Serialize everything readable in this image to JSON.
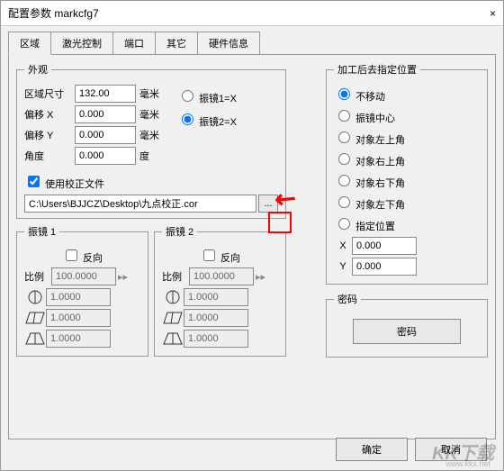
{
  "window": {
    "title": "配置参数 markcfg7"
  },
  "tabs": [
    "区域",
    "激光控制",
    "端口",
    "其它",
    "硬件信息"
  ],
  "appearance": {
    "legend": "外观",
    "size_label": "区域尺寸",
    "size_value": "132.00",
    "size_unit": "毫米",
    "offx_label": "偏移 X",
    "offx_value": "0.000",
    "offx_unit": "毫米",
    "offy_label": "偏移 Y",
    "offy_value": "0.000",
    "offy_unit": "毫米",
    "angle_label": "角度",
    "angle_value": "0.000",
    "angle_unit": "度",
    "mirror_opts": [
      "振镜1=X",
      "振镜2=X"
    ],
    "use_file_label": "使用校正文件",
    "file_path": "C:\\Users\\BJJCZ\\Desktop\\九点校正.cor",
    "browse_label": "..."
  },
  "mirror1": {
    "legend": "振镜 1",
    "rev_label": "反向",
    "ratio_label": "比例",
    "ratio": "100.0000",
    "v1": "1.0000",
    "v2": "1.0000",
    "v3": "1.0000"
  },
  "mirror2": {
    "legend": "振镜 2",
    "rev_label": "反向",
    "ratio_label": "比例",
    "ratio": "100.0000",
    "v1": "1.0000",
    "v2": "1.0000",
    "v3": "1.0000"
  },
  "postpos": {
    "legend": "加工后去指定位置",
    "opts": [
      "不移动",
      "振镜中心",
      "对象左上角",
      "对象右上角",
      "对象右下角",
      "对象左下角",
      "指定位置"
    ],
    "x_label": "X",
    "x_value": "0.000",
    "y_label": "Y",
    "y_value": "0.000"
  },
  "password": {
    "legend": "密码",
    "btn": "密码"
  },
  "footer": {
    "ok": "确定",
    "cancel": "取消"
  },
  "watermark": {
    "main": "KK下载",
    "sub": "www.kkx.net"
  }
}
